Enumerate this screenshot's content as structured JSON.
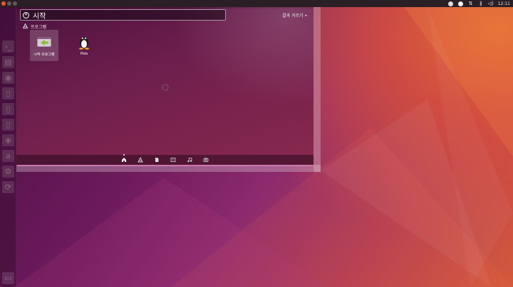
{
  "top_panel": {
    "clock": "12:11",
    "indicator_icons": [
      "telegram-icon",
      "circle-icon",
      "network-icon",
      "bluetooth-icon",
      "volume-icon"
    ]
  },
  "launcher": {
    "items": [
      {
        "name": "ubuntu-dash-icon",
        "active": true
      },
      {
        "name": "terminal-icon"
      },
      {
        "name": "files-icon"
      },
      {
        "name": "firefox-icon"
      },
      {
        "name": "writer-icon"
      },
      {
        "name": "calc-icon"
      },
      {
        "name": "impress-icon"
      },
      {
        "name": "software-center-icon"
      },
      {
        "name": "amazon-icon"
      },
      {
        "name": "settings-icon"
      },
      {
        "name": "update-icon"
      },
      {
        "name": "trash-icon"
      }
    ]
  },
  "dash": {
    "search_query": "시작",
    "filter_label": "결과 거르기",
    "category_label": "프로그램",
    "apps": [
      {
        "label": "시작 프로그램",
        "icon": "startup-applications-icon",
        "selected": true
      },
      {
        "label": "Polo",
        "icon": "tux-icon",
        "selected": false
      }
    ],
    "lenses": [
      {
        "icon": "home-icon",
        "active": true
      },
      {
        "icon": "applications-icon",
        "active": false
      },
      {
        "icon": "files-lens-icon",
        "active": false
      },
      {
        "icon": "video-icon",
        "active": false
      },
      {
        "icon": "music-icon",
        "active": false
      },
      {
        "icon": "photo-icon",
        "active": false
      }
    ]
  }
}
